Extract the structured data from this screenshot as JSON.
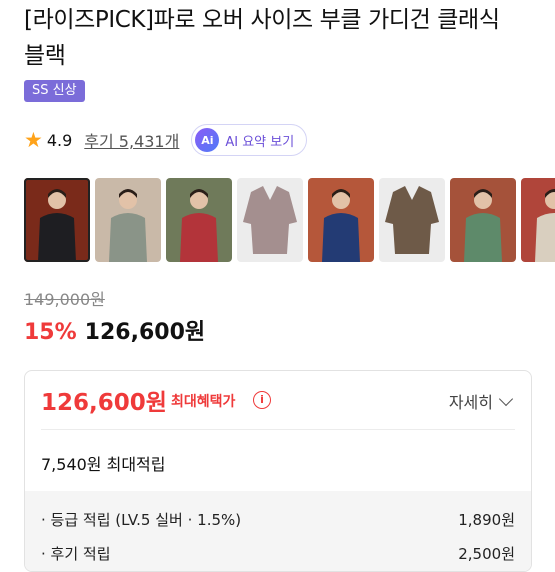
{
  "product": {
    "title_line1": "[라이즈PICK]파로 오버 사이즈 부클 가디건 클래식",
    "title_line2": "블랙",
    "badge": "SS 신상"
  },
  "rating": {
    "score": "4.9",
    "reviews_label": "후기 5,431개",
    "ai_icon_text": "Ai",
    "ai_summary_label": "AI 요약 보기"
  },
  "thumbnails": [
    {
      "alt": "model in black cardigan",
      "bg": "#7a2a1a",
      "fg": "#1e1e22"
    },
    {
      "alt": "models in mixed cardigans",
      "bg": "#c9b9a8",
      "fg": "#8a9488"
    },
    {
      "alt": "group in red cardigans",
      "bg": "#6f7a5a",
      "fg": "#b3343a"
    },
    {
      "alt": "mauve cardigan flat lay",
      "bg": "#ececec",
      "fg": "#a48f8f"
    },
    {
      "alt": "model in blue cardigan",
      "bg": "#b5573a",
      "fg": "#233b74"
    },
    {
      "alt": "brown cardigan flat lay",
      "bg": "#ececec",
      "fg": "#6e5a48"
    },
    {
      "alt": "model in green cardigan",
      "bg": "#a5523a",
      "fg": "#5e8a6a"
    },
    {
      "alt": "model in beige cardigan",
      "bg": "#b0453a",
      "fg": "#d9cfbf"
    }
  ],
  "pricing": {
    "original_price": "149,000원",
    "discount": "15%",
    "sale_price": "126,600원"
  },
  "benefit_panel": {
    "max_price": "126,600원",
    "max_label": "최대혜택가",
    "info_icon": "i",
    "detail_label": "자세히",
    "points_total": "7,540원 최대적립",
    "breakdown": [
      {
        "label": "· 등급 적립 (LV.5 실버 · 1.5%)",
        "value": "1,890원"
      },
      {
        "label": "· 후기 적립",
        "value": "2,500원"
      }
    ]
  }
}
